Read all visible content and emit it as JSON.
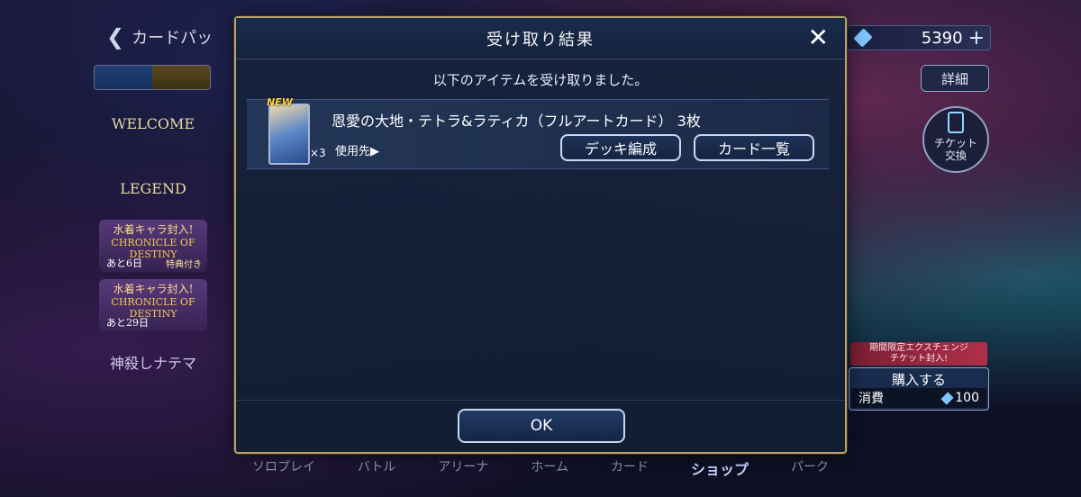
{
  "topbar": {
    "back_label": "カードパッ",
    "currency_amount": "5390"
  },
  "side_right": {
    "detail_label": "詳細",
    "ticket_label_1": "チケット",
    "ticket_label_2": "交換"
  },
  "banners": {
    "welcome": "WELCOME",
    "legend": "LEGEND",
    "chronicle_1": {
      "title": "水着キャラ封入!",
      "name": "CHRONICLE OF DESTINY",
      "days": "あと6日",
      "extra": "特典付き"
    },
    "chronicle_2": {
      "title": "水着キャラ封入!",
      "name": "CHRONICLE OF DESTINY",
      "days": "あと29日"
    },
    "god": "神殺しナテマ"
  },
  "purchase": {
    "tag_line1": "期間限定エクスチェンジ",
    "tag_line2": "チケット封入!",
    "buy_label": "購入する",
    "cost_label": "消費",
    "cost_value": "100"
  },
  "bottom_nav": [
    "ソロプレイ",
    "バトル",
    "アリーナ",
    "ホーム",
    "カード",
    "ショップ",
    "パーク"
  ],
  "modal": {
    "title": "受け取り結果",
    "subtitle": "以下のアイテムを受け取りました。",
    "item": {
      "badge": "NEW",
      "count_overlay": "×3",
      "name": "恩愛の大地・テトラ&ラティカ（フルアートカード） 3枚",
      "use_link": "使用先▶"
    },
    "deck_button": "デッキ編成",
    "list_button": "カード一覧",
    "ok_button": "OK"
  }
}
